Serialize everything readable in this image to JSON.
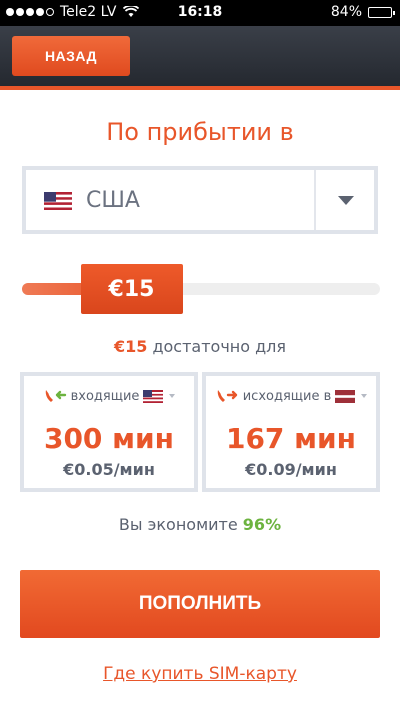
{
  "status_bar": {
    "carrier": "Tele2 LV",
    "time": "16:18",
    "battery_text": "84%",
    "battery_level": 0.84,
    "signal_bars": 4
  },
  "header": {
    "back_label": "НАЗАД"
  },
  "title": "По прибытии в",
  "country_select": {
    "value": "США",
    "flag": "us-flag-icon"
  },
  "slider": {
    "label": "€15",
    "fraction": 0.25
  },
  "enough": {
    "amount": "€15",
    "text": " достаточно для"
  },
  "incoming": {
    "label": "входящие",
    "minutes": "300 мин",
    "price": "€0.05/мин",
    "flag": "us-flag-icon"
  },
  "outgoing": {
    "label": "исходящие в",
    "minutes": "167 мин",
    "price": "€0.09/мин",
    "flag": "lv-flag-icon"
  },
  "savings": {
    "text": "Вы экономите ",
    "percent": "96%"
  },
  "topup_label": "ПОПОЛНИТЬ",
  "sim_link": "Где купить SIM-карту",
  "colors": {
    "accent": "#e8562a",
    "green": "#6cb33f",
    "text": "#5b6270",
    "border": "#dfe3ea"
  }
}
